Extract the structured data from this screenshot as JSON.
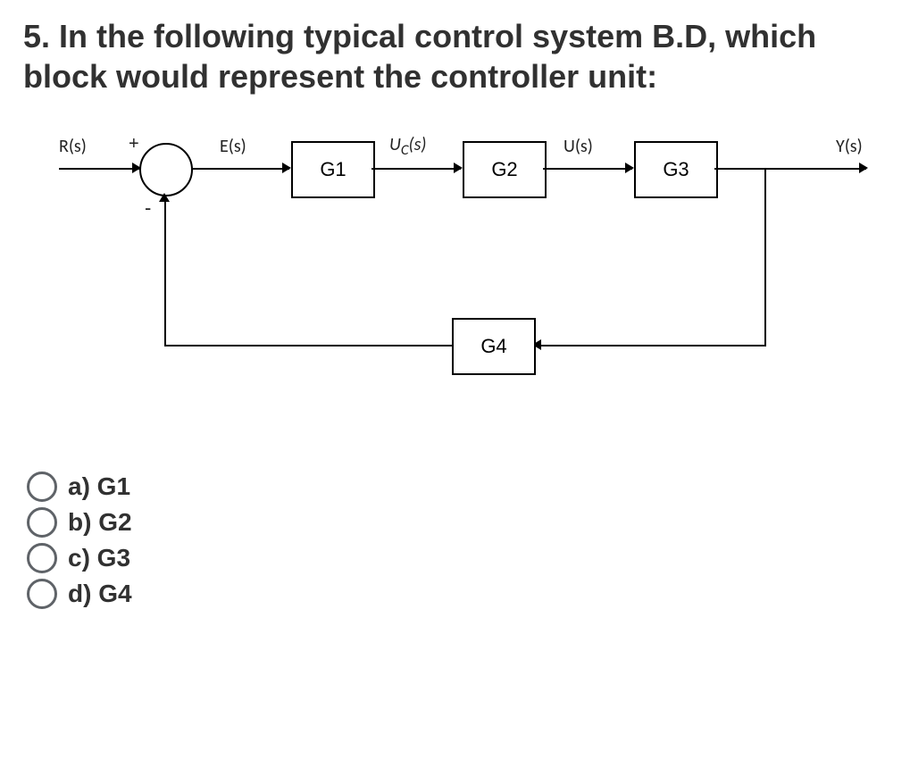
{
  "question": {
    "number": "5.",
    "text": "In the following typical control system B.D, which block would represent the controller unit:"
  },
  "diagram": {
    "signals": {
      "R": "R(s)",
      "E": "E(s)",
      "Uc": "U",
      "Uc_sub": "C",
      "Uc_tail": "(s)",
      "U": "U(s)",
      "Y": "Y(s)",
      "plus": "+",
      "minus": "-"
    },
    "blocks": {
      "g1": "G1",
      "g2": "G2",
      "g3": "G3",
      "g4": "G4"
    }
  },
  "options": {
    "a": "a) G1",
    "b": "b) G2",
    "c": "c) G3",
    "d": "d) G4"
  }
}
